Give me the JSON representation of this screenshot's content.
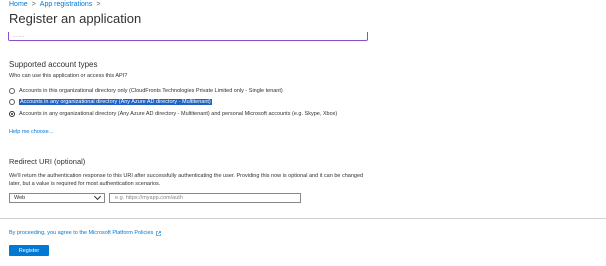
{
  "breadcrumb": {
    "home": "Home",
    "separator": ">",
    "current": "App registrations",
    "separator2": ">"
  },
  "page": {
    "title": "Register an application"
  },
  "name_field": {
    "partial_text": "... ...."
  },
  "account_types": {
    "section_title": "Supported account types",
    "question": "Who can use this application or access this API?",
    "options": [
      {
        "label": "Accounts in this organizational directory only (CloudFronts Technologies Private Limited only - Single tenant)",
        "selected": false,
        "highlighted": false
      },
      {
        "label": "Accounts in any organizational directory (Any Azure AD directory - Multitenant)",
        "selected": false,
        "highlighted": true
      },
      {
        "label": "Accounts in any organizational directory (Any Azure AD directory - Multitenant) and personal Microsoft accounts (e.g. Skype, Xbox)",
        "selected": true,
        "highlighted": false
      }
    ],
    "help_link": "Help me choose..."
  },
  "redirect": {
    "title": "Redirect URI (optional)",
    "description": "We'll return the authentication response to this URI after successfully authenticating the user. Providing this now is optional and it can be changed later, but a value is required for most authentication scenarios.",
    "platform_value": "Web",
    "uri_placeholder": "e.g. https://myapp.com/auth"
  },
  "footer": {
    "policy_text": "By proceeding, you agree to the Microsoft Platform Policies",
    "register_label": "Register"
  },
  "colors": {
    "accent": "#0078d4",
    "highlight": "#1e62c9",
    "input_focus": "#8a4fc7"
  }
}
